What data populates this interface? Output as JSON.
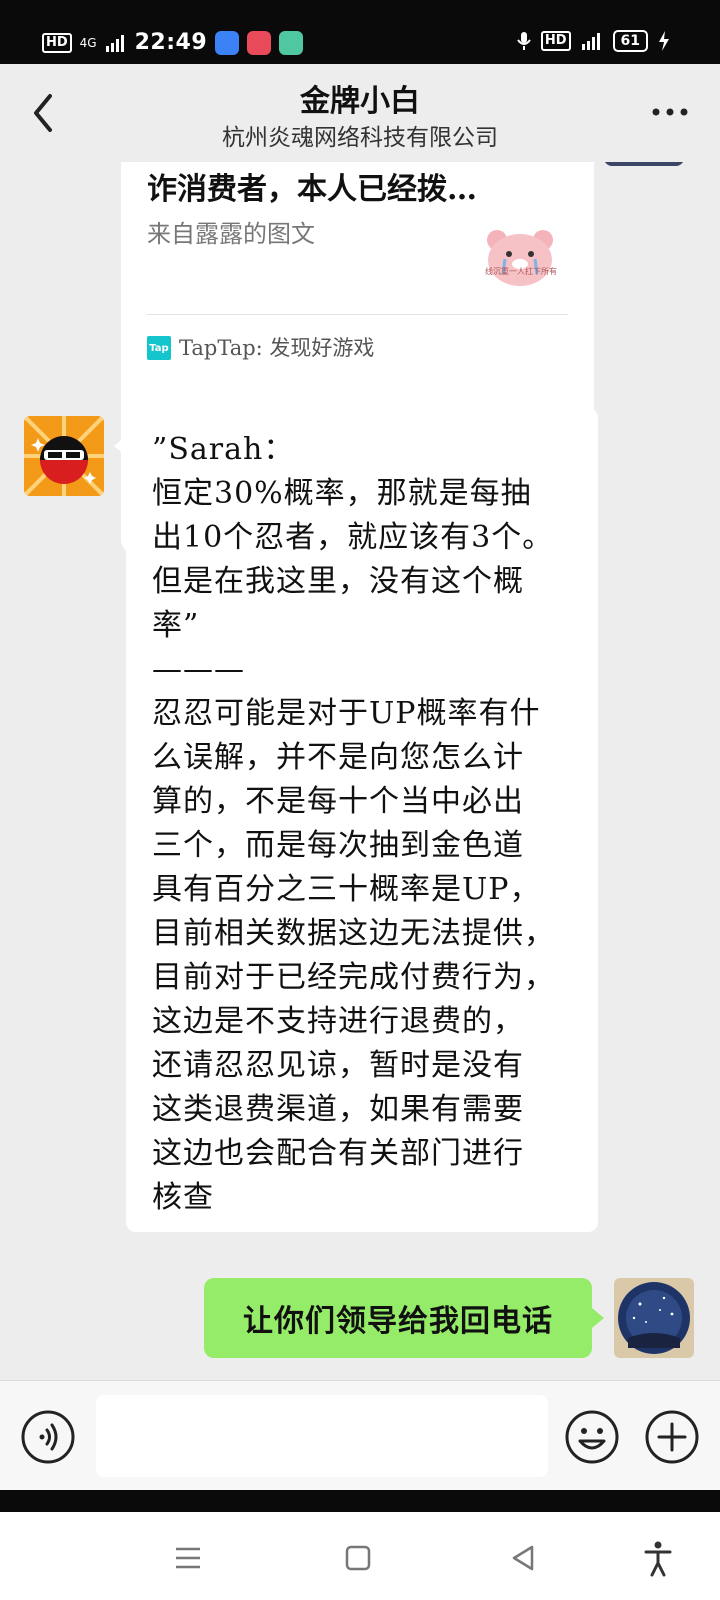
{
  "status_bar": {
    "left_badge": "HD",
    "network": "4G",
    "time": "22:49",
    "right_badge": "HD",
    "battery": "61",
    "app_icons": [
      {
        "name": "gallery-app-icon",
        "color": "#3b82f6"
      },
      {
        "name": "video-app-icon",
        "color": "#e94a5a"
      },
      {
        "name": "book-app-icon",
        "color": "#4fc7a0"
      }
    ]
  },
  "header": {
    "title": "金牌小白",
    "subtitle": "杭州炎魂网络科技有限公司"
  },
  "messages": {
    "share_card": {
      "title": "诈消费者，本人已经拨…",
      "source": "来自露露的图文",
      "sticker_caption": "线沉重一人扛下所有",
      "app_label": "TapTap: 发现好游戏",
      "app_logo": "Tap"
    },
    "reply": {
      "lines": [
        "”Sarah：",
        "恒定30%概率，那就是每抽",
        "出10个忍者，就应该有3个。",
        "但是在我这里，没有这个概",
        "率”",
        "———",
        "忍忍可能是对于UP概率有什",
        "么误解，并不是向您怎么计",
        "算的，不是每十个当中必出",
        "三个，而是每次抽到金色道",
        "具有百分之三十概率是UP，",
        "目前相关数据这边无法提供，",
        "目前对于已经完成付费行为，",
        "这边是不支持进行退费的，",
        "还请忍忍见谅，暂时是没有",
        "这类退费渠道，如果有需要",
        "这边也会配合有关部门进行",
        "核查"
      ]
    },
    "sent": {
      "text": "让你们领导给我回电话"
    }
  },
  "input": {
    "value": ""
  },
  "colors": {
    "background": "#ededed",
    "sent_bubble": "#95ec69",
    "received_bubble": "#ffffff"
  }
}
